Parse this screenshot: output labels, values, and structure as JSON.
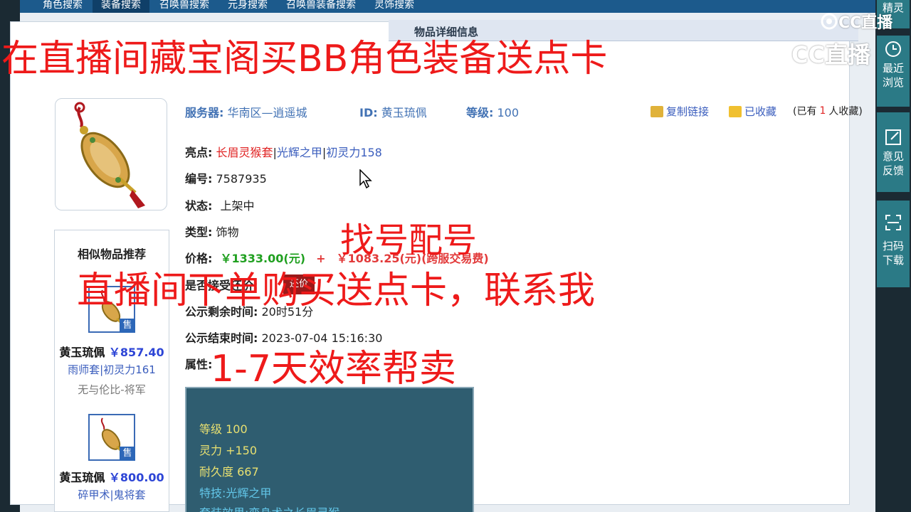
{
  "nav": {
    "tabs": [
      "角色搜索",
      "装备搜索",
      "召唤兽搜索",
      "元身搜索",
      "召唤兽装备搜索",
      "灵饰搜索"
    ],
    "active_index": 1
  },
  "panel": {
    "header": "物品详细信息"
  },
  "info": {
    "server_label": "服务器:",
    "server_value": "华南区—逍遥城",
    "id_label": "ID:",
    "id_value": "黄玉琉佩",
    "level_label": "等级:",
    "level_value": "100",
    "copy_link": "复制链接",
    "favorited": "已收藏",
    "fav_count_prefix": "(已有",
    "fav_count_num": "1",
    "fav_count_suffix": "人收藏)"
  },
  "details": {
    "highlight_label": "亮点:",
    "highlight_1": "长眉灵猴套",
    "highlight_2": "光辉之甲",
    "highlight_3": "初灵力158",
    "number_label": "编号:",
    "number_value": "7587935",
    "status_label": "状态:",
    "status_value": "上架中",
    "type_label": "类型:",
    "type_value": "饰物",
    "price_label": "价格:",
    "price_value": "￥1333.00(元)",
    "price_plus": "+",
    "price_fee": "￥1083.25(元)(跨服交易费)",
    "bid_label": "是否接受还价:",
    "bid_tag": "还价",
    "remain_label": "公示剩余时间:",
    "remain_value": "20时51分",
    "end_label": "公示结束时间:",
    "end_value": "2023-07-04 15:16:30",
    "attr_label": "属性:"
  },
  "attributes": {
    "level": "等级 100",
    "spirit": "灵力 +150",
    "durability": "耐久度 667",
    "skill": "特技:光辉之甲",
    "set": "套装效果:变身术之长眉灵猴"
  },
  "similar": {
    "title": "相似物品推荐",
    "items": [
      {
        "name": "黄玉琉佩",
        "price": "￥857.40",
        "sub": "雨师套|初灵力161",
        "server": "无与伦比-将军"
      },
      {
        "name": "黄玉琉佩",
        "price": "￥800.00",
        "sub": "碎甲术|鬼将套",
        "server": ""
      }
    ],
    "sale_badge": "售"
  },
  "rail": {
    "top_label": "精灵",
    "recent": "最近浏览",
    "feedback": "意见反馈",
    "scan": "扫码下载"
  },
  "watermark": {
    "logo": "CC直播"
  },
  "overlays": {
    "line1": "在直播间藏宝阁买BB角色装备送点卡",
    "line2": "找号配号",
    "line3": "直播间下单购买送点卡，联系我",
    "line4": "1-7天效率帮卖"
  },
  "colors": {
    "nav": "#1c5a8c",
    "overlay": "#ee1a1a",
    "rail": "#2b7a86"
  }
}
